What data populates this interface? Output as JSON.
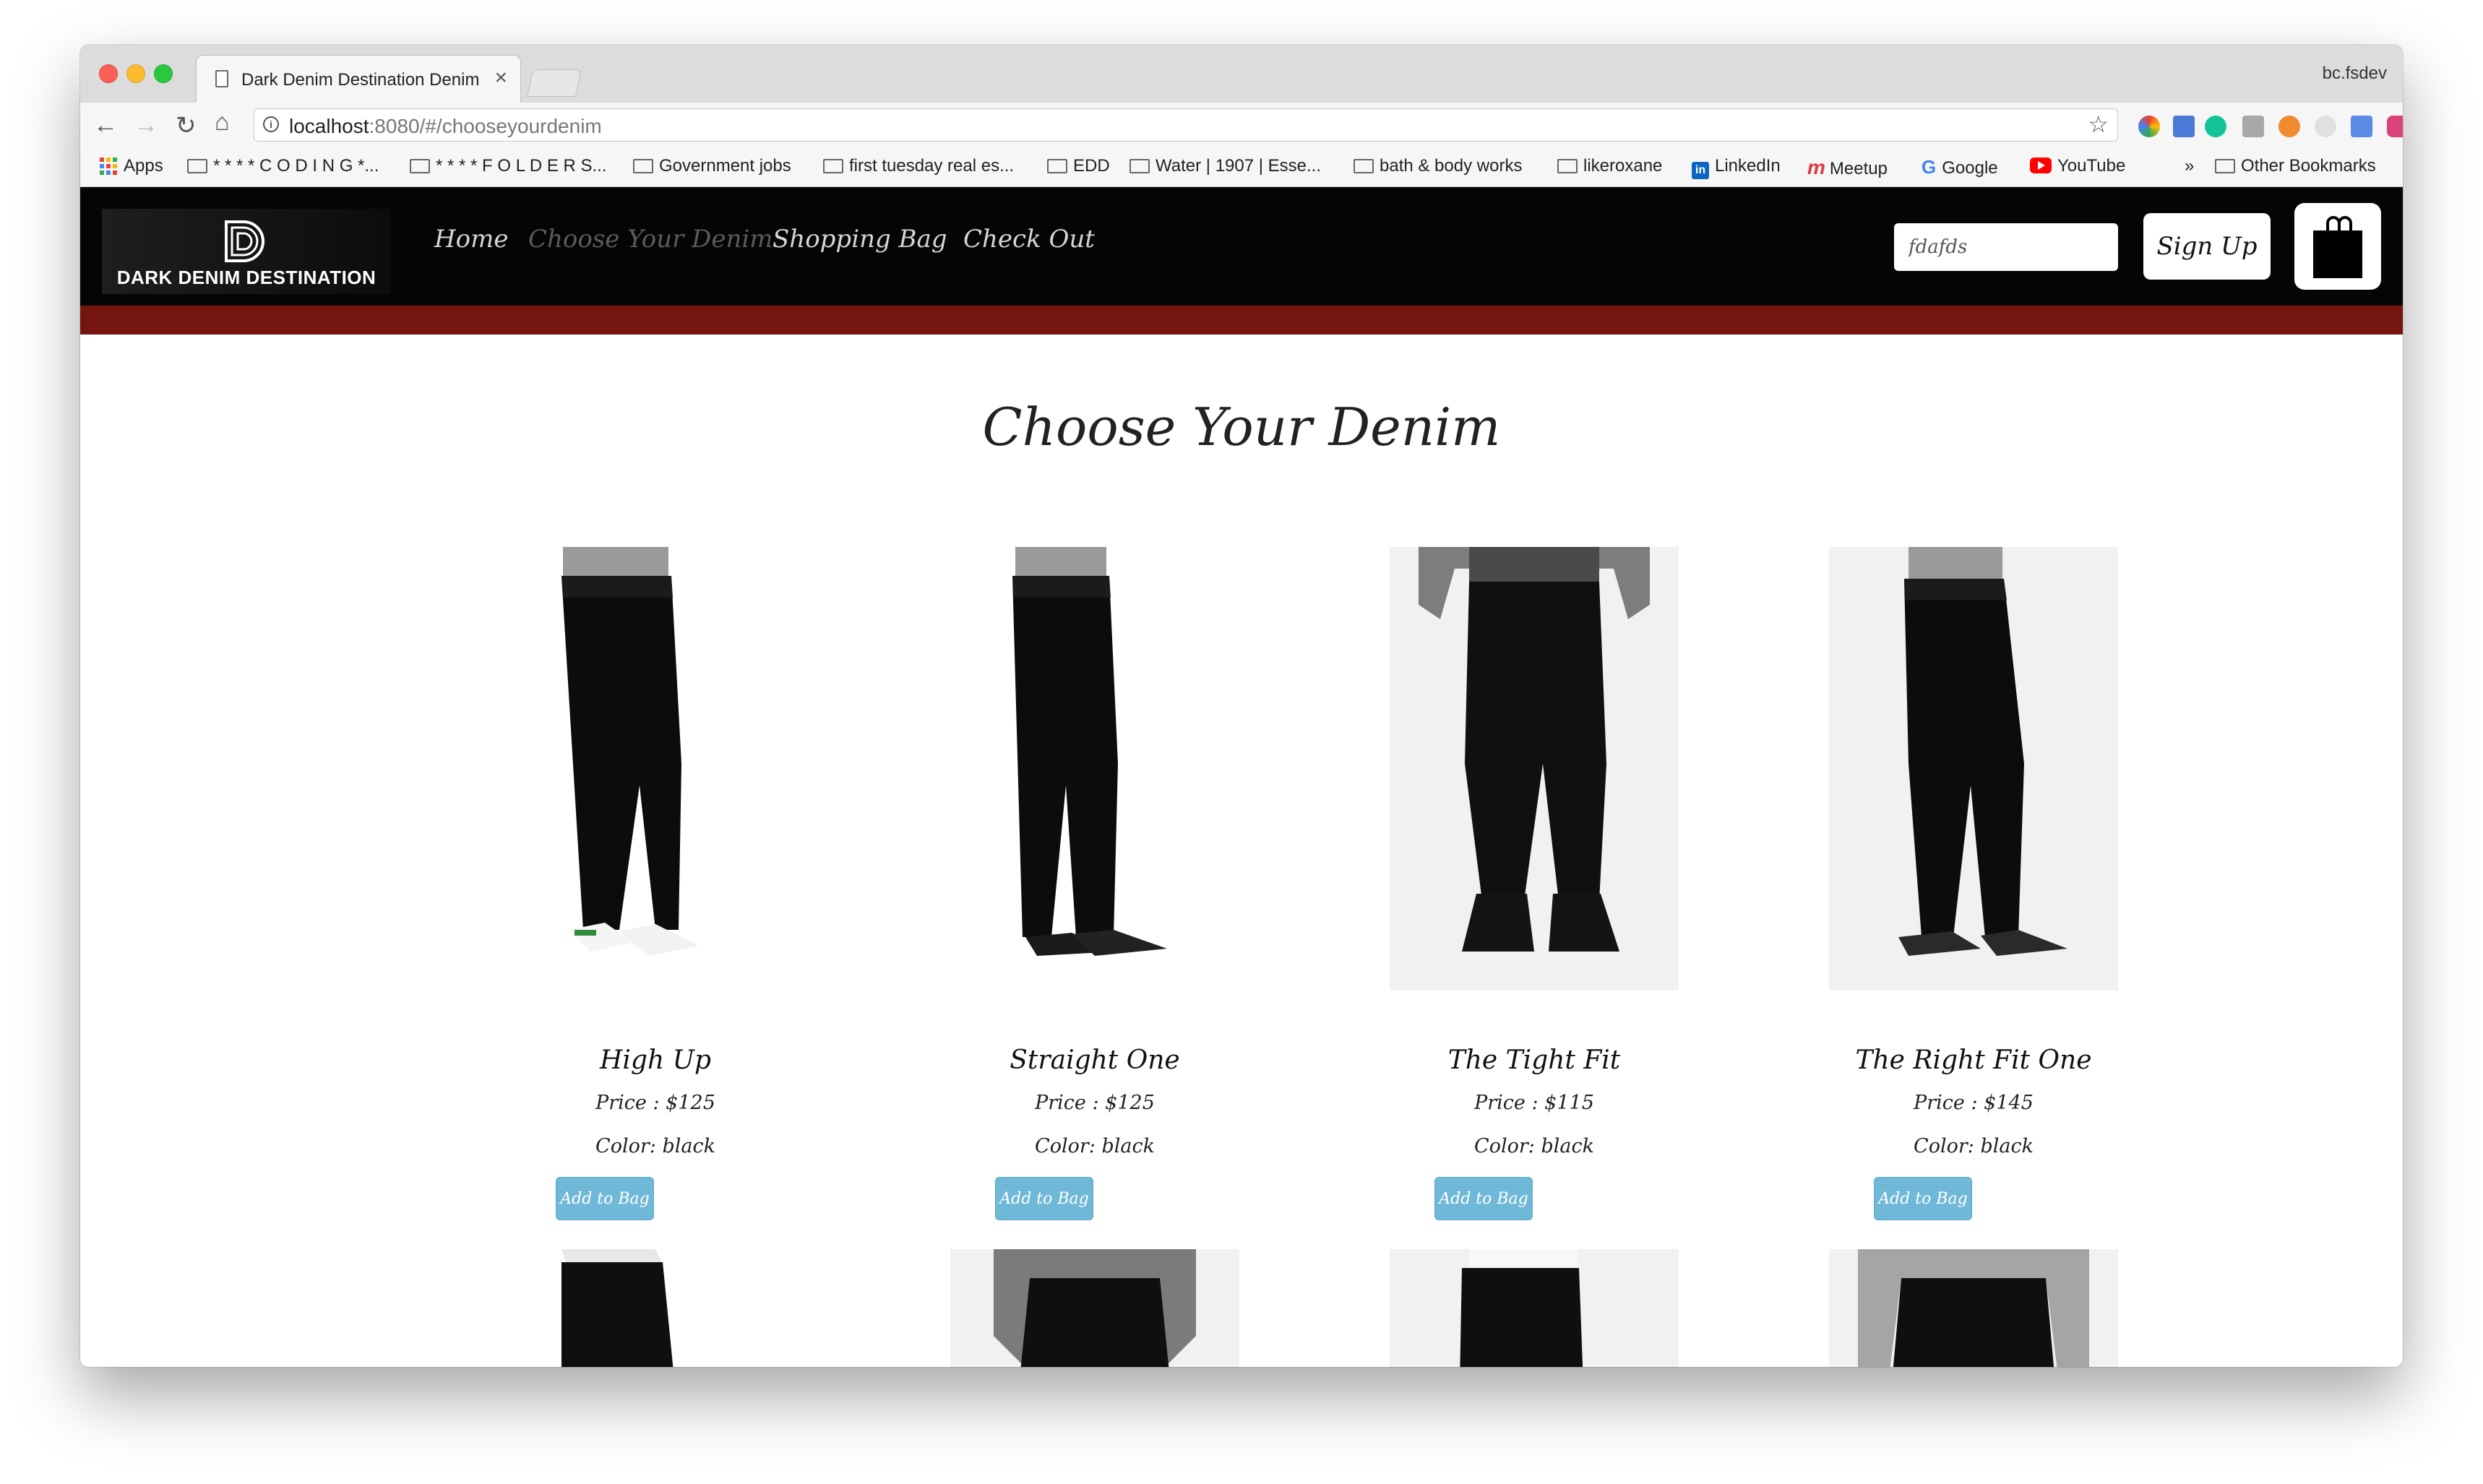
{
  "browser": {
    "tab_title": "Dark Denim Destination Denim",
    "tab_close": "×",
    "profile": "bc.fsdev",
    "url_host": "localhost",
    "url_rest": ":8080/#/chooseyourdenim",
    "bookmarks": [
      {
        "label": "Apps",
        "icon": "apps-icon"
      },
      {
        "label": "* * * * C O D I N G *...",
        "icon": "folder-icon"
      },
      {
        "label": "* * * * F O L D E R S...",
        "icon": "folder-icon"
      },
      {
        "label": "Government jobs",
        "icon": "folder-icon"
      },
      {
        "label": "first tuesday real es...",
        "icon": "folder-icon"
      },
      {
        "label": "EDD",
        "icon": "folder-icon"
      },
      {
        "label": "Water | 1907 | Esse...",
        "icon": "folder-icon"
      },
      {
        "label": "bath & body works",
        "icon": "folder-icon"
      },
      {
        "label": "likeroxane",
        "icon": "folder-icon"
      },
      {
        "label": "LinkedIn",
        "icon": "linkedin-icon"
      },
      {
        "label": "Meetup",
        "icon": "meetup-icon"
      },
      {
        "label": "Google",
        "icon": "google-icon"
      },
      {
        "label": "YouTube",
        "icon": "youtube-icon"
      }
    ],
    "overflow": "»",
    "other_bookmarks": "Other Bookmarks"
  },
  "site": {
    "logo_text": "DARK DENIM DESTINATION",
    "nav": [
      "Home",
      "Choose Your Denim",
      "Shopping Bag",
      "Check Out"
    ],
    "active_nav": "Choose Your Denim",
    "search_value": "fdafds",
    "signup_label": "Sign Up",
    "heading": "Choose Your Denim",
    "colors": {
      "navbar": "#050505",
      "accent_bar": "#741510",
      "add_button": "#6fb8d8"
    }
  },
  "products": [
    {
      "name": "High Up",
      "price": "Price : $125",
      "color": "Color: black",
      "button": "Add to Bag",
      "shoe": "white-sneaker"
    },
    {
      "name": "Straight One",
      "price": "Price : $125",
      "color": "Color: black",
      "button": "Add to Bag",
      "shoe": "black-sneaker"
    },
    {
      "name": "The Tight Fit",
      "price": "Price : $115",
      "color": "Color: black",
      "button": "Add to Bag",
      "shoe": "black-boot"
    },
    {
      "name": "The Right Fit One",
      "price": "Price : $145",
      "color": "Color: black",
      "button": "Add to Bag",
      "shoe": "black-sneaker"
    }
  ]
}
